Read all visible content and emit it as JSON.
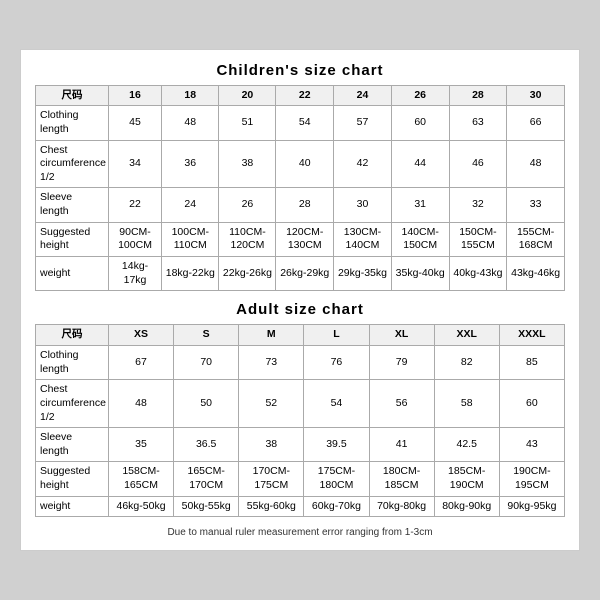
{
  "children_title": "Children's size chart",
  "adult_title": "Adult size chart",
  "note": "Due to manual ruler measurement error ranging from 1-3cm",
  "children": {
    "headers": [
      "尺码",
      "16",
      "18",
      "20",
      "22",
      "24",
      "26",
      "28",
      "30"
    ],
    "rows": [
      {
        "label": "Clothing\nlength",
        "values": [
          "45",
          "48",
          "51",
          "54",
          "57",
          "60",
          "63",
          "66"
        ]
      },
      {
        "label": "Chest\ncircumference\n1/2",
        "values": [
          "34",
          "36",
          "38",
          "40",
          "42",
          "44",
          "46",
          "48"
        ]
      },
      {
        "label": "Sleeve\nlength",
        "values": [
          "22",
          "24",
          "26",
          "28",
          "30",
          "31",
          "32",
          "33"
        ]
      },
      {
        "label": "Suggested\nheight",
        "values": [
          "90CM-100CM",
          "100CM-110CM",
          "110CM-120CM",
          "120CM-130CM",
          "130CM-140CM",
          "140CM-150CM",
          "150CM-155CM",
          "155CM-168CM"
        ]
      },
      {
        "label": "weight",
        "values": [
          "14kg-17kg",
          "18kg-22kg",
          "22kg-26kg",
          "26kg-29kg",
          "29kg-35kg",
          "35kg-40kg",
          "40kg-43kg",
          "43kg-46kg"
        ]
      }
    ]
  },
  "adult": {
    "headers": [
      "尺码",
      "XS",
      "S",
      "M",
      "L",
      "XL",
      "XXL",
      "XXXL"
    ],
    "rows": [
      {
        "label": "Clothing\nlength",
        "values": [
          "67",
          "70",
          "73",
          "76",
          "79",
          "82",
          "85"
        ]
      },
      {
        "label": "Chest\ncircumference\n1/2",
        "values": [
          "48",
          "50",
          "52",
          "54",
          "56",
          "58",
          "60"
        ]
      },
      {
        "label": "Sleeve\nlength",
        "values": [
          "35",
          "36.5",
          "38",
          "39.5",
          "41",
          "42.5",
          "43"
        ]
      },
      {
        "label": "Suggested\nheight",
        "values": [
          "158CM-165CM",
          "165CM-170CM",
          "170CM-175CM",
          "175CM-180CM",
          "180CM-185CM",
          "185CM-190CM",
          "190CM-195CM"
        ]
      },
      {
        "label": "weight",
        "values": [
          "46kg-50kg",
          "50kg-55kg",
          "55kg-60kg",
          "60kg-70kg",
          "70kg-80kg",
          "80kg-90kg",
          "90kg-95kg"
        ]
      }
    ]
  }
}
